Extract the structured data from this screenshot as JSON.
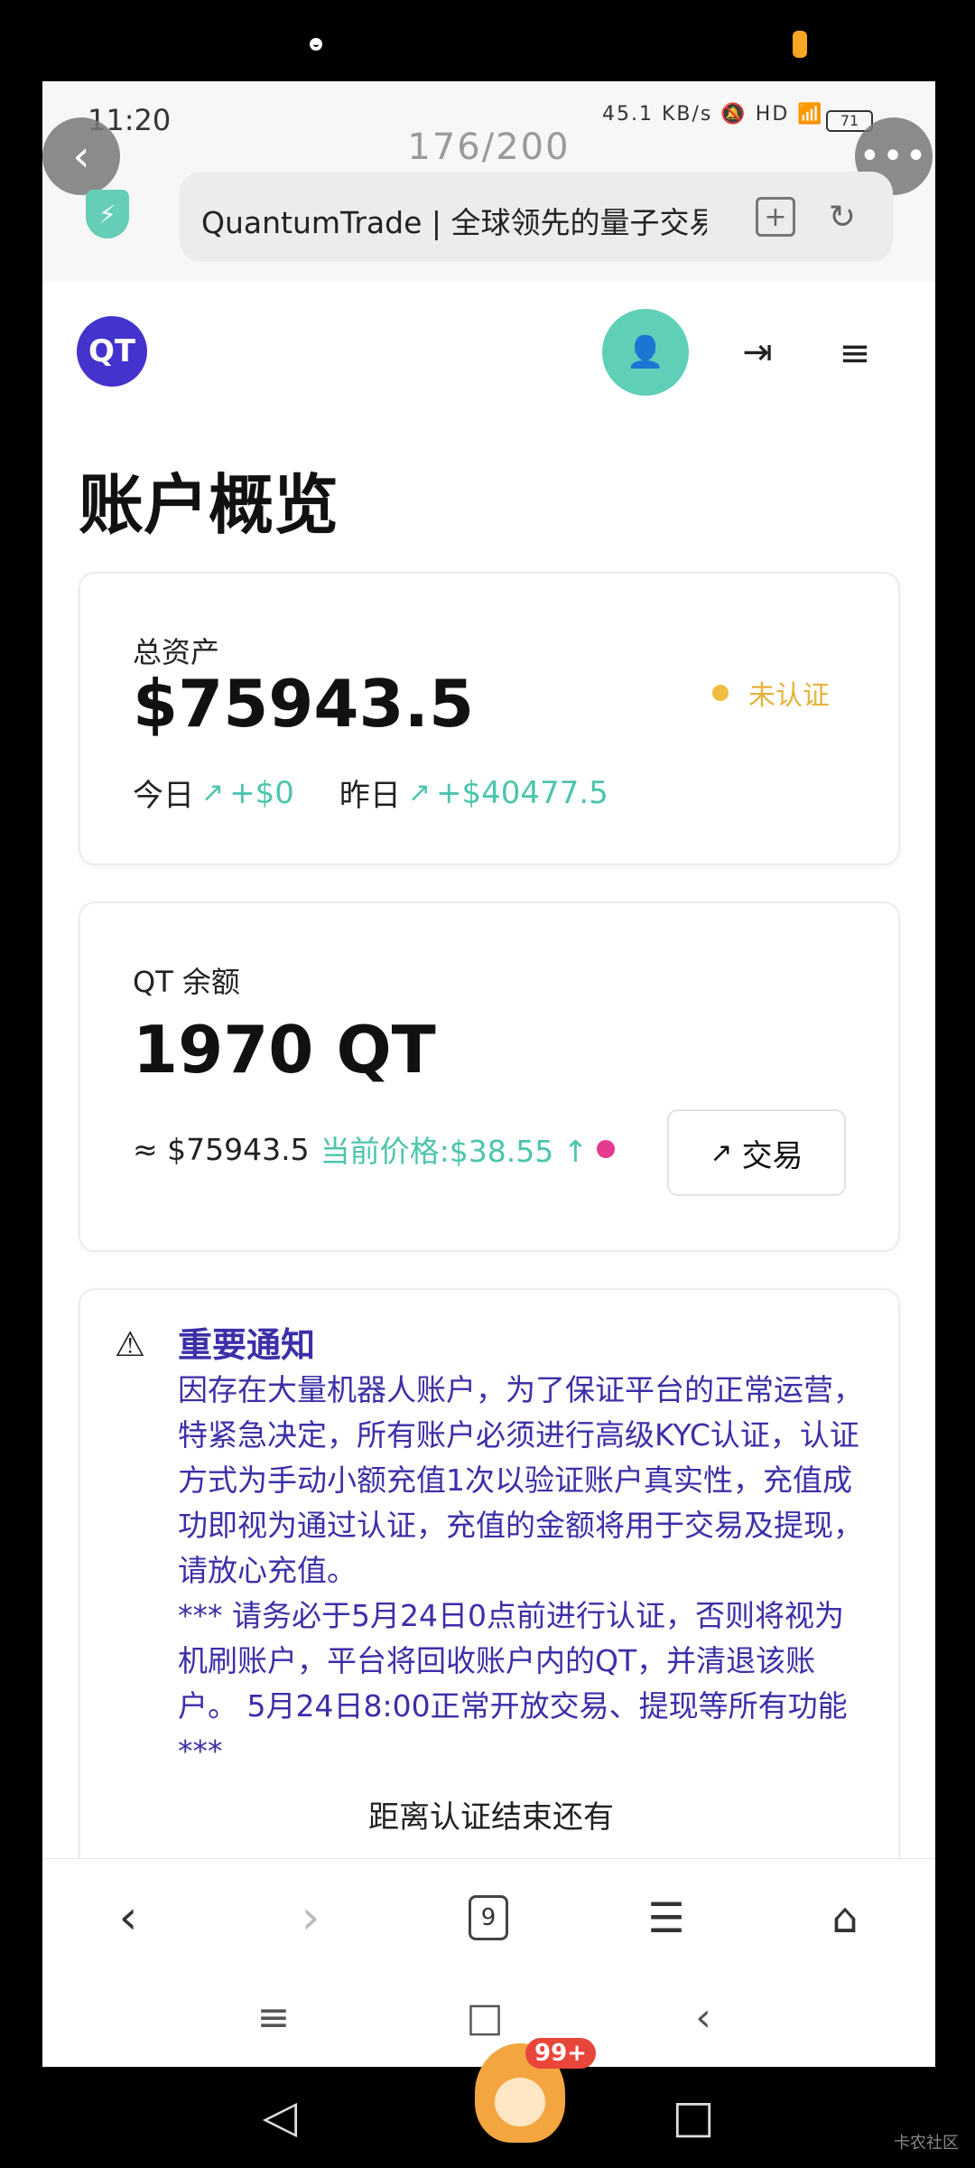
{
  "status_bar": {
    "time": "11:20",
    "net_speed": "45.1 KB/s",
    "network": "HD",
    "battery": "71"
  },
  "browser": {
    "page_counter": "176/200",
    "url_title": "QuantumTrade | 全球领先的量子交易",
    "icons": {
      "back": "chevron-left-icon",
      "more": "more-dots-icon",
      "security": "shield-bolt-icon",
      "bookmark": "bookmark-add-icon",
      "refresh": "refresh-icon"
    }
  },
  "header": {
    "logo_text": "QT"
  },
  "page": {
    "title": "账户概览"
  },
  "assets_card": {
    "label": "总资产",
    "total": "$75943.5",
    "status": "未认证",
    "today_label": "今日",
    "today_change": "+$0",
    "yesterday_label": "昨日",
    "yesterday_change": "+$40477.5"
  },
  "balance_card": {
    "label": "QT 余额",
    "amount": "1970 QT",
    "approx": "≈ $75943.5",
    "price": "当前价格:$38.55 ↑",
    "trade_button": "交易"
  },
  "notice": {
    "title": "重要通知",
    "paragraph1": "因存在大量机器人账户，为了保证平台的正常运营，特紧急决定，所有账户必须进行高级KYC认证，认证方式为手动小额充值1次以验证账户真实性，充值成功即视为通过认证，充值的金额将用于交易及提现，请放心充值。",
    "paragraph2": "*** 请务必于5月24日0点前进行认证，否则将视为机刷账户，平台将回收账户内的QT，并清退该账户。 5月24日8:00正常开放交易、提现等所有功能 ***",
    "countdown_label": "距离认证结束还有"
  },
  "browser_nav": {
    "tab_count": "9"
  },
  "floating": {
    "badge": "99+"
  },
  "watermark": "卡农社区",
  "colors": {
    "accent_teal": "#4cc5ad",
    "brand_purple": "#4433cc",
    "notice_text": "#3c2fa8",
    "warning_yellow": "#e5b33a",
    "live_dot": "#e53a8e"
  }
}
